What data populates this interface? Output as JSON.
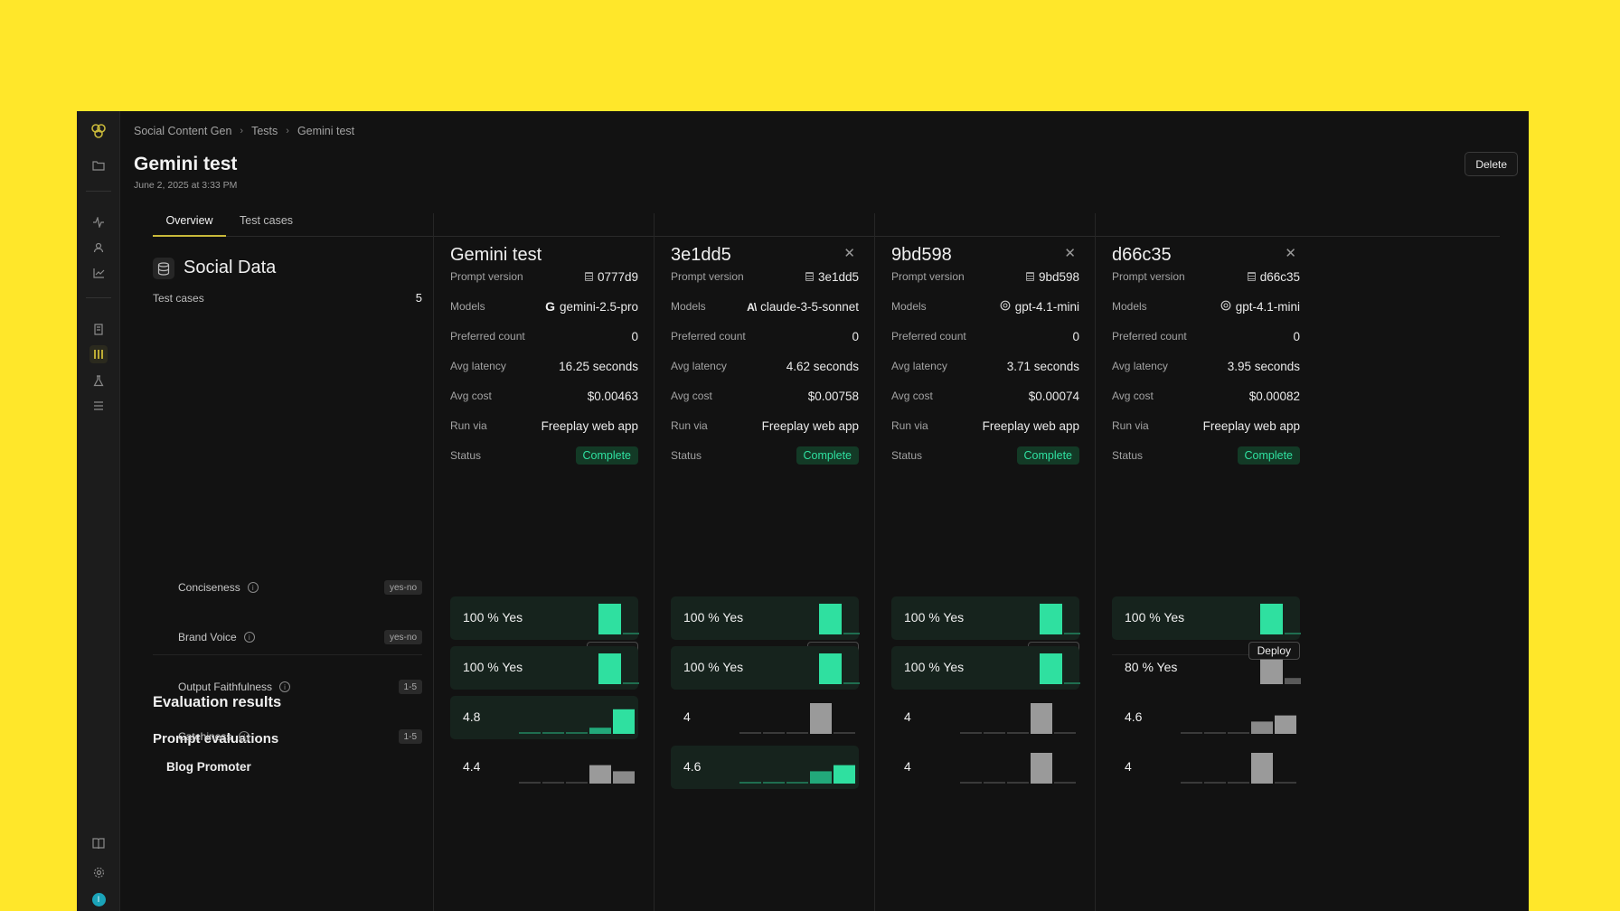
{
  "breadcrumb": [
    "Social Content Gen",
    "Tests",
    "Gemini test"
  ],
  "page": {
    "title": "Gemini test",
    "date": "June 2, 2025 at 3:33 PM",
    "delete_label": "Delete"
  },
  "tabs": [
    {
      "label": "Overview",
      "active": true
    },
    {
      "label": "Test cases",
      "active": false
    }
  ],
  "dataset": {
    "name": "Social Data",
    "test_cases_label": "Test cases",
    "test_cases": "5"
  },
  "evaluation": {
    "heading": "Evaluation results",
    "prompt_evaluations": "Prompt evaluations",
    "group": "Blog Promoter",
    "rows": [
      {
        "name": "Conciseness",
        "type": "yes-no"
      },
      {
        "name": "Brand Voice",
        "type": "yes-no"
      },
      {
        "name": "Output Faithfulness",
        "type": "1-5"
      },
      {
        "name": "Catchiness",
        "type": "1-5"
      }
    ]
  },
  "labels": {
    "prompt_version": "Prompt version",
    "models": "Models",
    "preferred_count": "Preferred count",
    "avg_latency": "Avg latency",
    "avg_cost": "Avg cost",
    "run_via": "Run via",
    "status": "Status",
    "deploy": "Deploy"
  },
  "colors": {
    "accent": "#2fe0a0",
    "best_bg": "#16231d",
    "neutral_bar": "#9a9a9a",
    "yellow_bg": "#FFE72A"
  },
  "columns": [
    {
      "name": "Gemini test",
      "closable": false,
      "prompt_version": "0777d9",
      "model": "gemini-2.5-pro",
      "model_icon": "google-icon",
      "preferred_count": "0",
      "avg_latency": "16.25 seconds",
      "avg_cost": "$0.00463",
      "run_via": "Freeplay web app",
      "status": "Complete",
      "evals": [
        {
          "label": "100 % Yes",
          "best": true,
          "kind": "yesno",
          "yes": 1.0
        },
        {
          "label": "100 % Yes",
          "best": true,
          "kind": "yesno",
          "yes": 1.0
        },
        {
          "label": "4.8",
          "best": true,
          "kind": "scale",
          "dist": [
            0,
            0,
            0,
            0.2,
            0.8
          ]
        },
        {
          "label": "4.4",
          "best": false,
          "kind": "scale",
          "dist": [
            0,
            0,
            0,
            0.6,
            0.4
          ]
        }
      ]
    },
    {
      "name": "3e1dd5",
      "closable": true,
      "prompt_version": "3e1dd5",
      "model": "claude-3-5-sonnet",
      "model_icon": "anthropic-icon",
      "preferred_count": "0",
      "avg_latency": "4.62 seconds",
      "avg_cost": "$0.00758",
      "run_via": "Freeplay web app",
      "status": "Complete",
      "evals": [
        {
          "label": "100 % Yes",
          "best": true,
          "kind": "yesno",
          "yes": 1.0
        },
        {
          "label": "100 % Yes",
          "best": true,
          "kind": "yesno",
          "yes": 1.0
        },
        {
          "label": "4",
          "best": false,
          "kind": "scale",
          "dist": [
            0,
            0,
            0,
            1.0,
            0
          ]
        },
        {
          "label": "4.6",
          "best": true,
          "kind": "scale",
          "dist": [
            0,
            0,
            0,
            0.4,
            0.6
          ]
        }
      ]
    },
    {
      "name": "9bd598",
      "closable": true,
      "prompt_version": "9bd598",
      "model": "gpt-4.1-mini",
      "model_icon": "openai-icon",
      "preferred_count": "0",
      "avg_latency": "3.71 seconds",
      "avg_cost": "$0.00074",
      "run_via": "Freeplay web app",
      "status": "Complete",
      "evals": [
        {
          "label": "100 % Yes",
          "best": true,
          "kind": "yesno",
          "yes": 1.0
        },
        {
          "label": "100 % Yes",
          "best": true,
          "kind": "yesno",
          "yes": 1.0
        },
        {
          "label": "4",
          "best": false,
          "kind": "scale",
          "dist": [
            0,
            0,
            0,
            1.0,
            0
          ]
        },
        {
          "label": "4",
          "best": false,
          "kind": "scale",
          "dist": [
            0,
            0,
            0,
            1.0,
            0
          ]
        }
      ]
    },
    {
      "name": "d66c35",
      "closable": true,
      "prompt_version": "d66c35",
      "model": "gpt-4.1-mini",
      "model_icon": "openai-icon",
      "preferred_count": "0",
      "avg_latency": "3.95 seconds",
      "avg_cost": "$0.00082",
      "run_via": "Freeplay web app",
      "status": "Complete",
      "evals": [
        {
          "label": "100 % Yes",
          "best": true,
          "kind": "yesno",
          "yes": 1.0
        },
        {
          "label": "80 % Yes",
          "best": false,
          "kind": "yesno",
          "yes": 0.8
        },
        {
          "label": "4.6",
          "best": false,
          "kind": "scale",
          "dist": [
            0,
            0,
            0,
            0.4,
            0.6
          ]
        },
        {
          "label": "4",
          "best": false,
          "kind": "scale",
          "dist": [
            0,
            0,
            0,
            1.0,
            0
          ]
        }
      ]
    }
  ]
}
